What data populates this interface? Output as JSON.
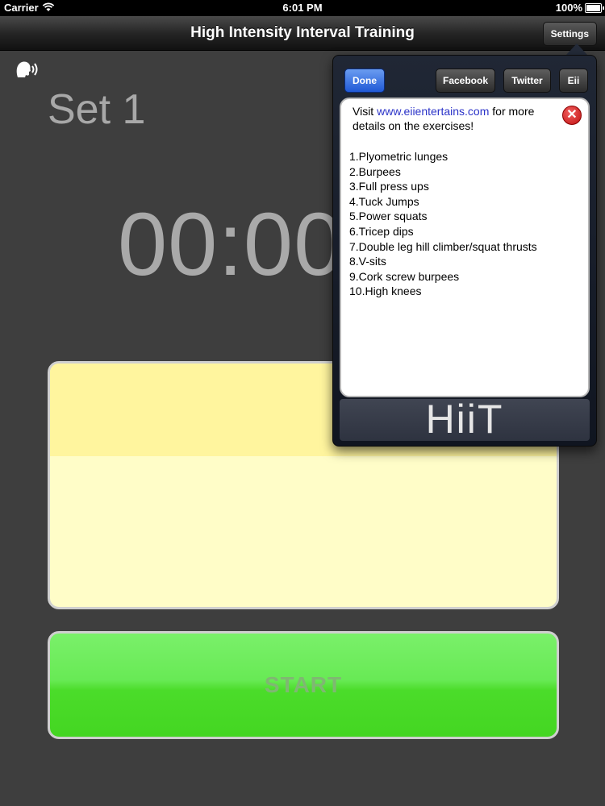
{
  "status_bar": {
    "carrier": "Carrier",
    "time": "6:01 PM",
    "battery": "100%"
  },
  "nav": {
    "title": "High Intensity Interval Training",
    "settings_label": "Settings"
  },
  "main": {
    "speaker_icon": "speaker-voice-icon",
    "set_label": "Set 1",
    "timer": "00:00",
    "start_label": "START"
  },
  "popover": {
    "toolbar": {
      "done": "Done",
      "facebook": "Facebook",
      "twitter": "Twitter",
      "eii": "Eii"
    },
    "intro_prefix": "Visit ",
    "intro_link": "www.eiientertains.com",
    "intro_suffix": " for more details on the exercises!",
    "exercises": [
      "1.Plyometric lunges",
      "2.Burpees",
      "3.Full press ups",
      "4.Tuck Jumps",
      "5.Power squats",
      "6.Tricep dips",
      "7.Double leg hill climber/squat thrusts",
      "8.V-sits",
      "9.Cork screw burpees",
      "10.High knees"
    ],
    "logo_text": "HiiT"
  },
  "colors": {
    "done_button": "#2f64dc",
    "start_green": "#5de540",
    "panel_yellow": "#fff59e",
    "close_red": "#d42020",
    "link_blue": "#2b33c8"
  }
}
